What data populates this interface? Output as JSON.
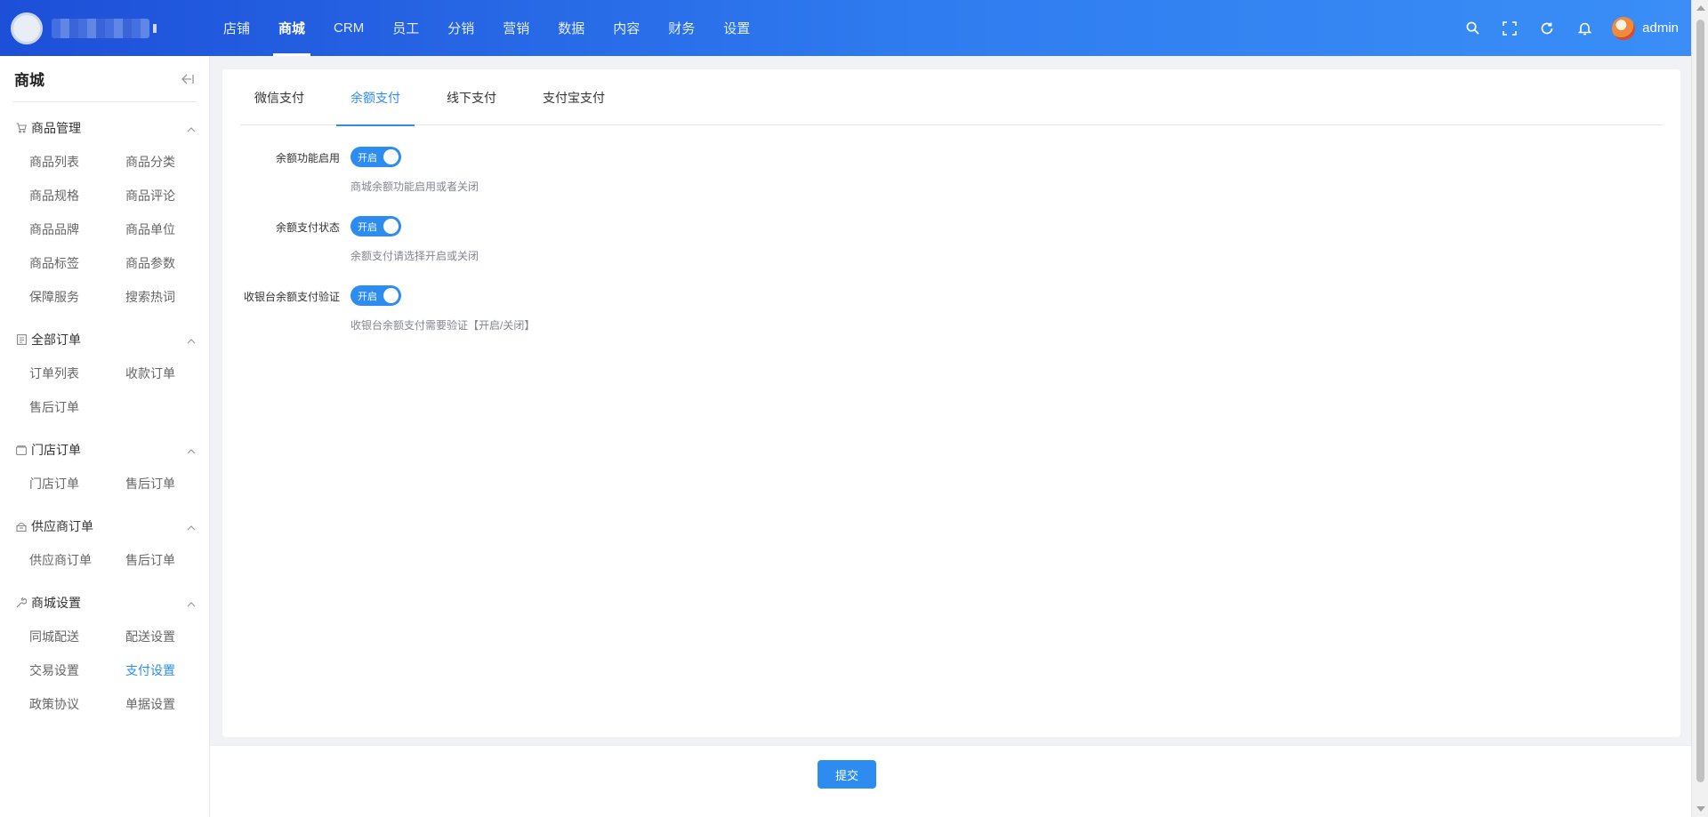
{
  "topnav": {
    "items": [
      {
        "label": "店铺"
      },
      {
        "label": "商城"
      },
      {
        "label": "CRM"
      },
      {
        "label": "员工"
      },
      {
        "label": "分销"
      },
      {
        "label": "营销"
      },
      {
        "label": "数据"
      },
      {
        "label": "内容"
      },
      {
        "label": "财务"
      },
      {
        "label": "设置"
      }
    ],
    "active": "商城",
    "user": "admin",
    "icons": [
      "search-icon",
      "fullscreen-icon",
      "refresh-icon",
      "bell-icon"
    ]
  },
  "sidebar": {
    "title": "商城",
    "groups": [
      {
        "label": "商品管理",
        "icon": "cart-icon",
        "items": [
          "商品列表",
          "商品分类",
          "商品规格",
          "商品评论",
          "商品品牌",
          "商品单位",
          "商品标签",
          "商品参数",
          "保障服务",
          "搜索热词"
        ]
      },
      {
        "label": "全部订单",
        "icon": "document-icon",
        "items": [
          "订单列表",
          "收款订单",
          "售后订单"
        ]
      },
      {
        "label": "门店订单",
        "icon": "store-icon",
        "items": [
          "门店订单",
          "售后订单"
        ]
      },
      {
        "label": "供应商订单",
        "icon": "supplier-icon",
        "items": [
          "供应商订单",
          "售后订单"
        ]
      },
      {
        "label": "商城设置",
        "icon": "wrench-icon",
        "items": [
          "同城配送",
          "配送设置",
          "交易设置",
          "支付设置",
          "政策协议",
          "单据设置"
        ]
      }
    ],
    "active_item": "支付设置"
  },
  "tabs": [
    {
      "label": "微信支付"
    },
    {
      "label": "余额支付"
    },
    {
      "label": "线下支付"
    },
    {
      "label": "支付宝支付"
    }
  ],
  "active_tab": "余额支付",
  "form": [
    {
      "label": "余额功能启用",
      "switch_text": "开启",
      "on": true,
      "tip": "商城余额功能启用或者关闭"
    },
    {
      "label": "余额支付状态",
      "switch_text": "开启",
      "on": true,
      "tip": "余额支付请选择开启或关闭"
    },
    {
      "label": "收银台余额支付验证",
      "switch_text": "开启",
      "on": true,
      "tip": "收银台余额支付需要验证【开启/关闭】"
    }
  ],
  "submit_label": "提交",
  "colors": {
    "primary": "#2d8cf0",
    "header_start": "#1d4fd8",
    "header_end": "#3a8ef6"
  }
}
